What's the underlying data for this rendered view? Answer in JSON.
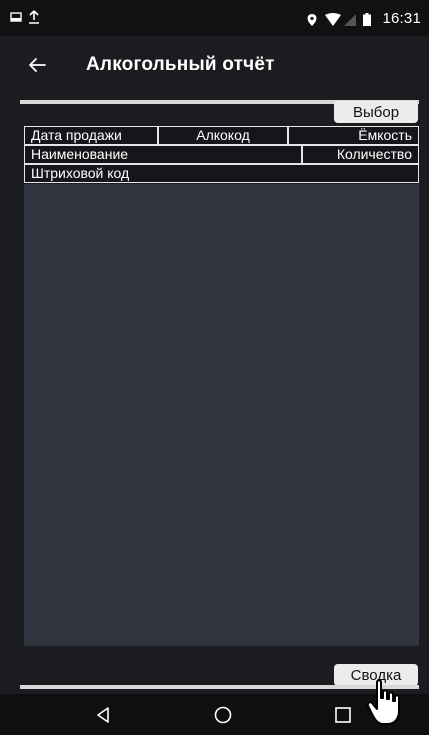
{
  "status": {
    "time": "16:31",
    "left_icons": [
      "notification-icon",
      "upload-icon"
    ],
    "right_icons": [
      "location-icon",
      "wifi-icon",
      "signal-icon",
      "battery-icon"
    ]
  },
  "toolbar": {
    "title": "Алкогольный отчёт"
  },
  "buttons": {
    "select_label": "Выбор",
    "summary_label": "Сводка"
  },
  "table_headers": {
    "row1": [
      "Дата продажи",
      "Алкокод",
      "Ёмкость"
    ],
    "row2": [
      "Наименование",
      "Количество"
    ],
    "row3": [
      "Штриховой код"
    ]
  },
  "colors": {
    "background": "#1b1c1f",
    "list_background": "#30343f",
    "button_background": "#ececec"
  }
}
